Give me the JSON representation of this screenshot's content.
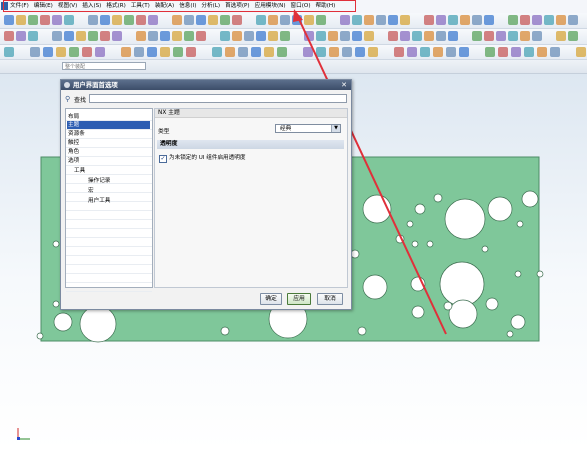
{
  "menu": {
    "items": [
      "文件(F)",
      "编辑(E)",
      "视图(V)",
      "插入(S)",
      "格式(R)",
      "工具(T)",
      "装配(A)",
      "信息(I)",
      "分析(L)",
      "首选项(P)",
      "应用模块(N)",
      "窗口(O)",
      "帮助(H)"
    ]
  },
  "toolbar": {
    "filter_placeholder": "整个装配"
  },
  "dialog": {
    "title": "用户界面首选项",
    "close": "✕",
    "find_label": "查找",
    "tree": {
      "items": [
        {
          "label": "布局"
        },
        {
          "label": "主题"
        },
        {
          "label": "资源条"
        },
        {
          "label": "触控"
        },
        {
          "label": "角色"
        },
        {
          "label": "选项"
        },
        {
          "label": "工具"
        },
        {
          "label": "操作记录"
        },
        {
          "label": "宏"
        },
        {
          "label": "用户工具"
        }
      ]
    },
    "panel": {
      "header": "NX 主题",
      "type_label": "类型",
      "type_value": "经典",
      "section_title": "透明度",
      "checkbox_label": "为未锁定的 UI 组件启用透明度",
      "checkbox_checked": true
    },
    "buttons": {
      "ok": "确定",
      "apply": "应用",
      "cancel": "取消"
    }
  },
  "colors": {
    "plate": "#7fc79a",
    "annotation": "#e0303a",
    "selection": "#2c5db2"
  }
}
